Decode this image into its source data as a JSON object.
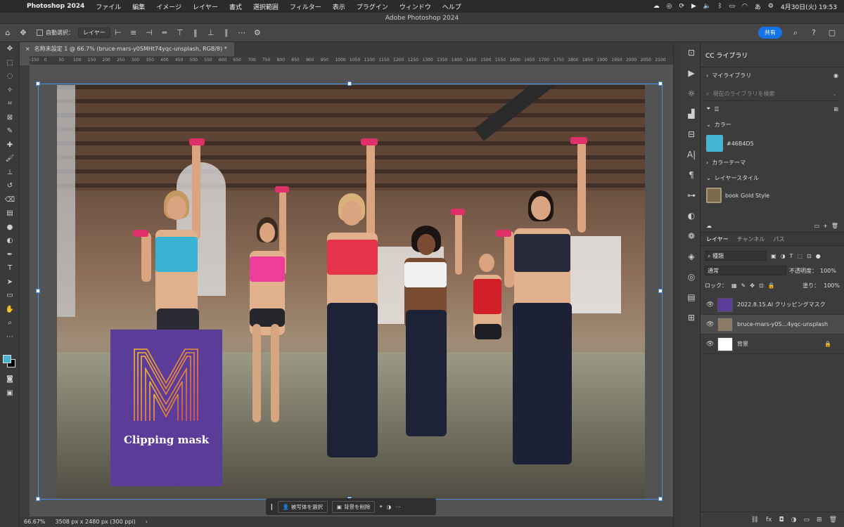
{
  "menubar": {
    "app": "Photoshop 2024",
    "items": [
      "ファイル",
      "編集",
      "イメージ",
      "レイヤー",
      "書式",
      "選択範囲",
      "フィルター",
      "表示",
      "プラグイン",
      "ウィンドウ",
      "ヘルプ"
    ],
    "input_source": "あ",
    "datetime": "4月30日(火)  19:53"
  },
  "window": {
    "title": "Adobe Photoshop 2024"
  },
  "options": {
    "auto_select_label": "自動選択：",
    "auto_select_target": "レイヤー",
    "share_label": "共有"
  },
  "document": {
    "tab_title": "名称未設定 1 @ 66.7% (bruce-mars-y0SMHt74yqc-unsplash, RGB/8) *",
    "close": "×",
    "ruler": [
      "-150",
      "0",
      "50",
      "100",
      "150",
      "200",
      "250",
      "300",
      "350",
      "400",
      "450",
      "500",
      "550",
      "600",
      "650",
      "700",
      "750",
      "800",
      "850",
      "900",
      "950",
      "1000",
      "1050",
      "1100",
      "1150",
      "1200",
      "1250",
      "1300",
      "1350",
      "1400",
      "1450",
      "1500",
      "1550",
      "1600",
      "1650",
      "1700",
      "1750",
      "1800",
      "1850",
      "1900",
      "1950",
      "2000",
      "2050",
      "2100"
    ],
    "clip_text": "Clipping mask",
    "zoom": "66.67%",
    "size_info": "3508 px x 2480 px (300 ppi)"
  },
  "contextbar": {
    "select_subject": "被写体を選択",
    "remove_bg": "背景を削除"
  },
  "libraries": {
    "tab": "CC ライブラリ",
    "my_library": "マイライブラリ",
    "search_placeholder": "現在のライブラリを検索",
    "colors_header": "カラー",
    "color_value": "#46B4D5",
    "color_theme_header": "カラーテーマ",
    "layer_styles_header": "レイヤースタイル",
    "style_name": "book Gold Style"
  },
  "layers": {
    "tabs": [
      "レイヤー",
      "チャンネル",
      "パス"
    ],
    "filter_kind": "種類",
    "blend_mode": "通常",
    "opacity_label": "不透明度：",
    "opacity_value": "100%",
    "lock_label": "ロック：",
    "fill_label": "塗り：",
    "fill_value": "100%",
    "items": [
      {
        "name": "2022.8.15.AI クリッピングマスク",
        "selected": false
      },
      {
        "name": "bruce-mars-y0S...4yqc-unsplash",
        "selected": true
      },
      {
        "name": "背景",
        "selected": false
      }
    ]
  },
  "colors": {
    "accent": "#1473e6",
    "foreground": "#46b4d5",
    "background": "#000000",
    "clip_card": "#5b3d99"
  }
}
